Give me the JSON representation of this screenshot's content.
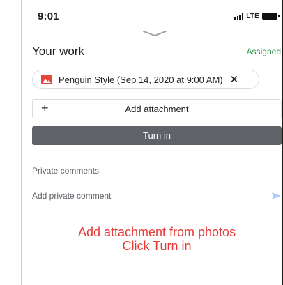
{
  "status_bar": {
    "time": "9:01",
    "network": "LTE"
  },
  "header": {
    "title": "Your work",
    "status": "Assigned"
  },
  "attachment_chip": {
    "label": "Penguin Style (Sep 14, 2020 at 9:00 AM)",
    "close_glyph": "✕",
    "icon": "image-icon"
  },
  "actions": {
    "add_attachment_glyph": "+",
    "add_attachment_label": "Add attachment",
    "turn_in_label": "Turn in"
  },
  "private_comments": {
    "heading": "Private comments",
    "placeholder": "Add private comment",
    "send_icon": "send-icon"
  },
  "instructions": {
    "line1": "Add attachment from photos",
    "line2": "Click Turn in"
  },
  "colors": {
    "assigned_green": "#1e8e3e",
    "turn_in_gray": "#5f6368",
    "image_icon_red": "#e8453c",
    "instruction_red": "#e53935",
    "send_icon_blue": "#aecbfa"
  }
}
